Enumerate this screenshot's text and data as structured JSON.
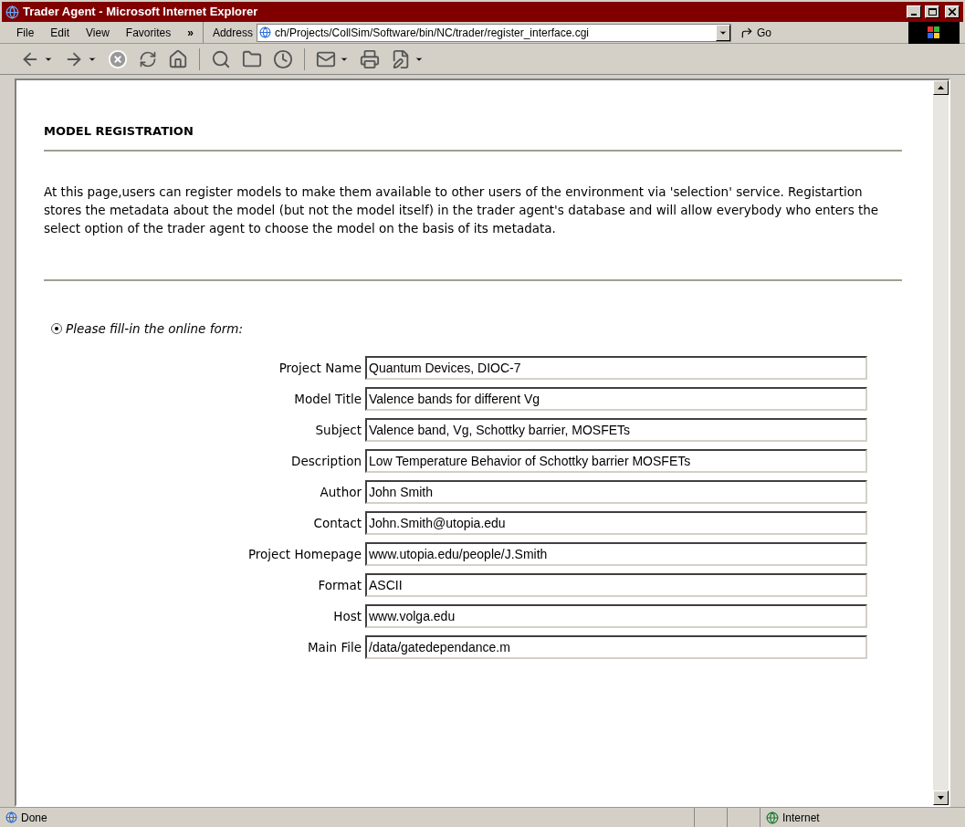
{
  "window": {
    "title": "Trader Agent - Microsoft Internet Explorer"
  },
  "menu": [
    {
      "label": "File"
    },
    {
      "label": "Edit"
    },
    {
      "label": "View"
    },
    {
      "label": "Favorites"
    }
  ],
  "menu_overflow": "»",
  "address": {
    "label": "Address",
    "value": "ch/Projects/CollSim/Software/bin/NC/trader/register_interface.cgi"
  },
  "go_button": "Go",
  "page": {
    "heading": "MODEL REGISTRATION",
    "intro": "At this page,users can register models to make them available to other users of the environment via 'selection' service. Registartion stores the metadata about the model (but not the model itself) in the trader agent's database and will allow everybody who enters the select option of the trader agent to choose the model on the basis of its metadata.",
    "option": {
      "label": "Please fill-in the online form:",
      "selected": true
    },
    "fields": [
      {
        "label": "Project Name",
        "value": "Quantum Devices, DIOC-7"
      },
      {
        "label": "Model Title",
        "value": "Valence bands for different Vg"
      },
      {
        "label": "Subject",
        "value": "Valence band, Vg, Schottky barrier, MOSFETs"
      },
      {
        "label": "Description",
        "value": "Low Temperature Behavior of Schottky barrier MOSFETs"
      },
      {
        "label": "Author",
        "value": "John Smith"
      },
      {
        "label": "Contact",
        "value": "John.Smith@utopia.edu"
      },
      {
        "label": "Project Homepage",
        "value": "www.utopia.edu/people/J.Smith"
      },
      {
        "label": "Format",
        "value": "ASCII"
      },
      {
        "label": "Host",
        "value": "www.volga.edu"
      },
      {
        "label": "Main File",
        "value": "/data/gatedependance.m"
      }
    ]
  },
  "status_bar": {
    "text": "Done",
    "zone": "Internet"
  }
}
